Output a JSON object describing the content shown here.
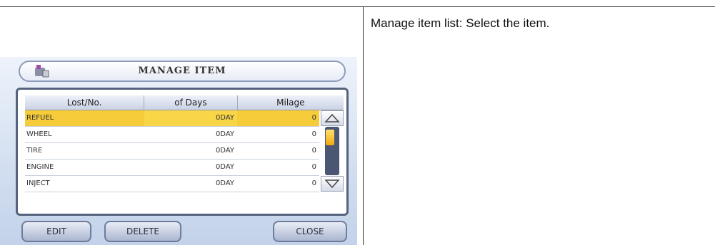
{
  "description": "Manage item list: Select the item.",
  "screen": {
    "title": "MANAGE ITEM",
    "columns": [
      "Lost/No.",
      "of Days",
      "Milage"
    ],
    "rows": [
      {
        "name": "REFUEL",
        "days": "0DAY",
        "milage": "0",
        "selected": true
      },
      {
        "name": "WHEEL",
        "days": "0DAY",
        "milage": "0",
        "selected": false
      },
      {
        "name": "TIRE",
        "days": "0DAY",
        "milage": "0",
        "selected": false
      },
      {
        "name": "ENGINE",
        "days": "0DAY",
        "milage": "0",
        "selected": false
      },
      {
        "name": "INJECT",
        "days": "0DAY",
        "milage": "0",
        "selected": false
      }
    ],
    "buttons": {
      "edit": "EDIT",
      "delete": "DELETE",
      "close": "CLOSE"
    },
    "icons": {
      "title_icon": "wrench-car-icon",
      "scroll_up": "triangle-up-icon",
      "scroll_down": "triangle-down-icon"
    },
    "colors": {
      "selected_row": "#f6cc3a",
      "frame": "#55637e",
      "scroll_thumb": "#f2a712"
    }
  }
}
